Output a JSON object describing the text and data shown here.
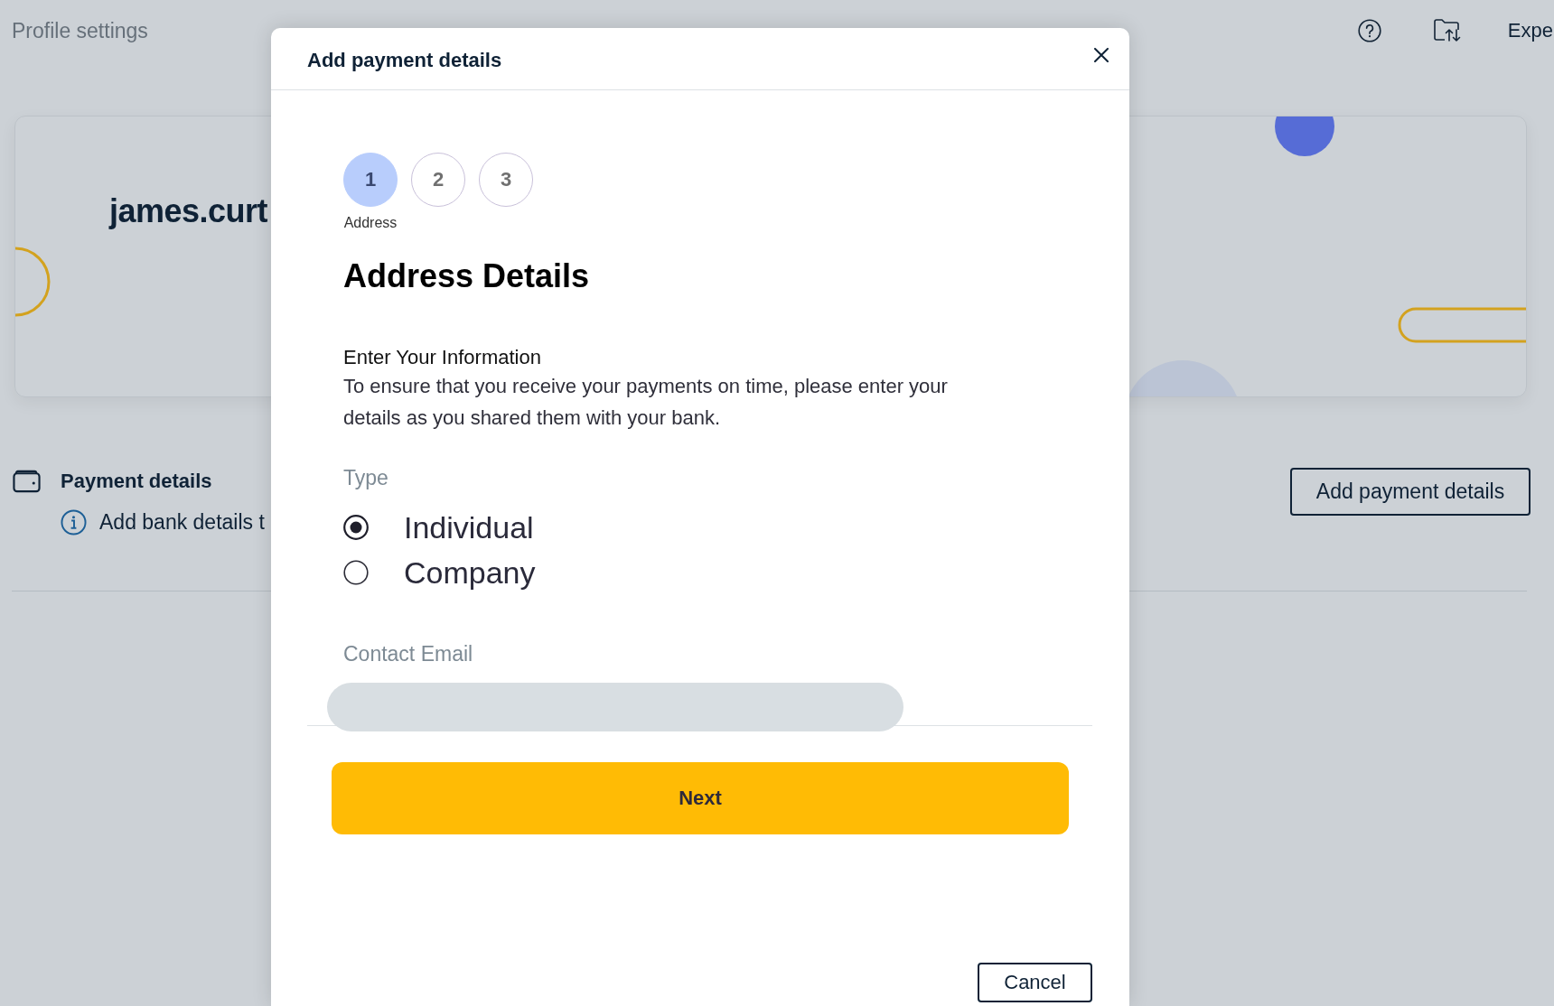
{
  "header": {
    "title": "Profile settings",
    "link": "Expe"
  },
  "profile_card": {
    "username": "james.curt"
  },
  "payment_section": {
    "title": "Payment details",
    "notice": "Add bank details t",
    "button": "Add payment details"
  },
  "modal": {
    "title": "Add payment details",
    "steps": [
      {
        "number": "1",
        "label": "Address",
        "selected": true
      },
      {
        "number": "2",
        "selected": false
      },
      {
        "number": "3",
        "selected": false
      }
    ],
    "heading": "Address Details",
    "intro": {
      "title": "Enter Your Information",
      "text": "To ensure that you receive your payments on time, please enter your details as you shared them with your bank."
    },
    "type_field": {
      "label": "Type",
      "options": [
        {
          "label": "Individual",
          "selected": true
        },
        {
          "label": "Company",
          "selected": false
        }
      ]
    },
    "email_field": {
      "label": "Contact Email",
      "redacted": true
    },
    "buttons": [
      {
        "kind": "primary",
        "label": "Next"
      },
      {
        "kind": "secondary",
        "label": "Cancel"
      }
    ]
  }
}
